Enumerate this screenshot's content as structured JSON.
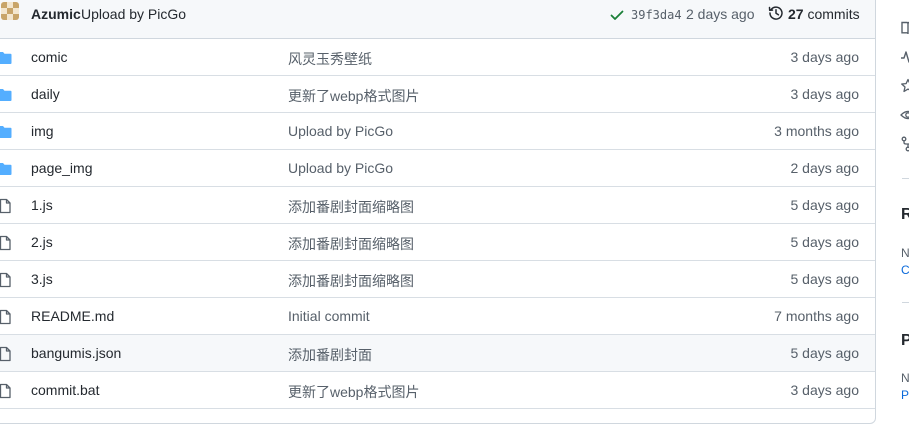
{
  "commit": {
    "author": "Azumic",
    "message": "Upload by PicGo",
    "sha": "39f3da4",
    "time": "2 days ago",
    "commits_count": "27",
    "commits_label": "commits"
  },
  "files": [
    {
      "type": "folder",
      "name": "comic",
      "message": "风灵玉秀壁纸",
      "age": "3 days ago"
    },
    {
      "type": "folder",
      "name": "daily",
      "message": "更新了webp格式图片",
      "age": "3 days ago"
    },
    {
      "type": "folder",
      "name": "img",
      "message": "Upload by PicGo",
      "age": "3 months ago"
    },
    {
      "type": "folder",
      "name": "page_img",
      "message": "Upload by PicGo",
      "age": "2 days ago"
    },
    {
      "type": "file",
      "name": "1.js",
      "message": "添加番剧封面缩略图",
      "age": "5 days ago"
    },
    {
      "type": "file",
      "name": "2.js",
      "message": "添加番剧封面缩略图",
      "age": "5 days ago"
    },
    {
      "type": "file",
      "name": "3.js",
      "message": "添加番剧封面缩略图",
      "age": "5 days ago"
    },
    {
      "type": "file",
      "name": "README.md",
      "message": "Initial commit",
      "age": "7 months ago"
    },
    {
      "type": "file",
      "name": "bangumis.json",
      "message": "添加番剧封面",
      "age": "5 days ago"
    },
    {
      "type": "file",
      "name": "commit.bat",
      "message": "更新了webp格式图片",
      "age": "3 days ago"
    }
  ],
  "sidebar": {
    "section1_head": "R",
    "section1_line1": "N",
    "section1_line2": "C",
    "section2_head": "P",
    "section2_line1": "N",
    "section2_line2": "P"
  },
  "colors": {
    "folder": "#54aeff",
    "link": "#0969da",
    "success": "#1a7f37",
    "muted": "#57606a"
  }
}
